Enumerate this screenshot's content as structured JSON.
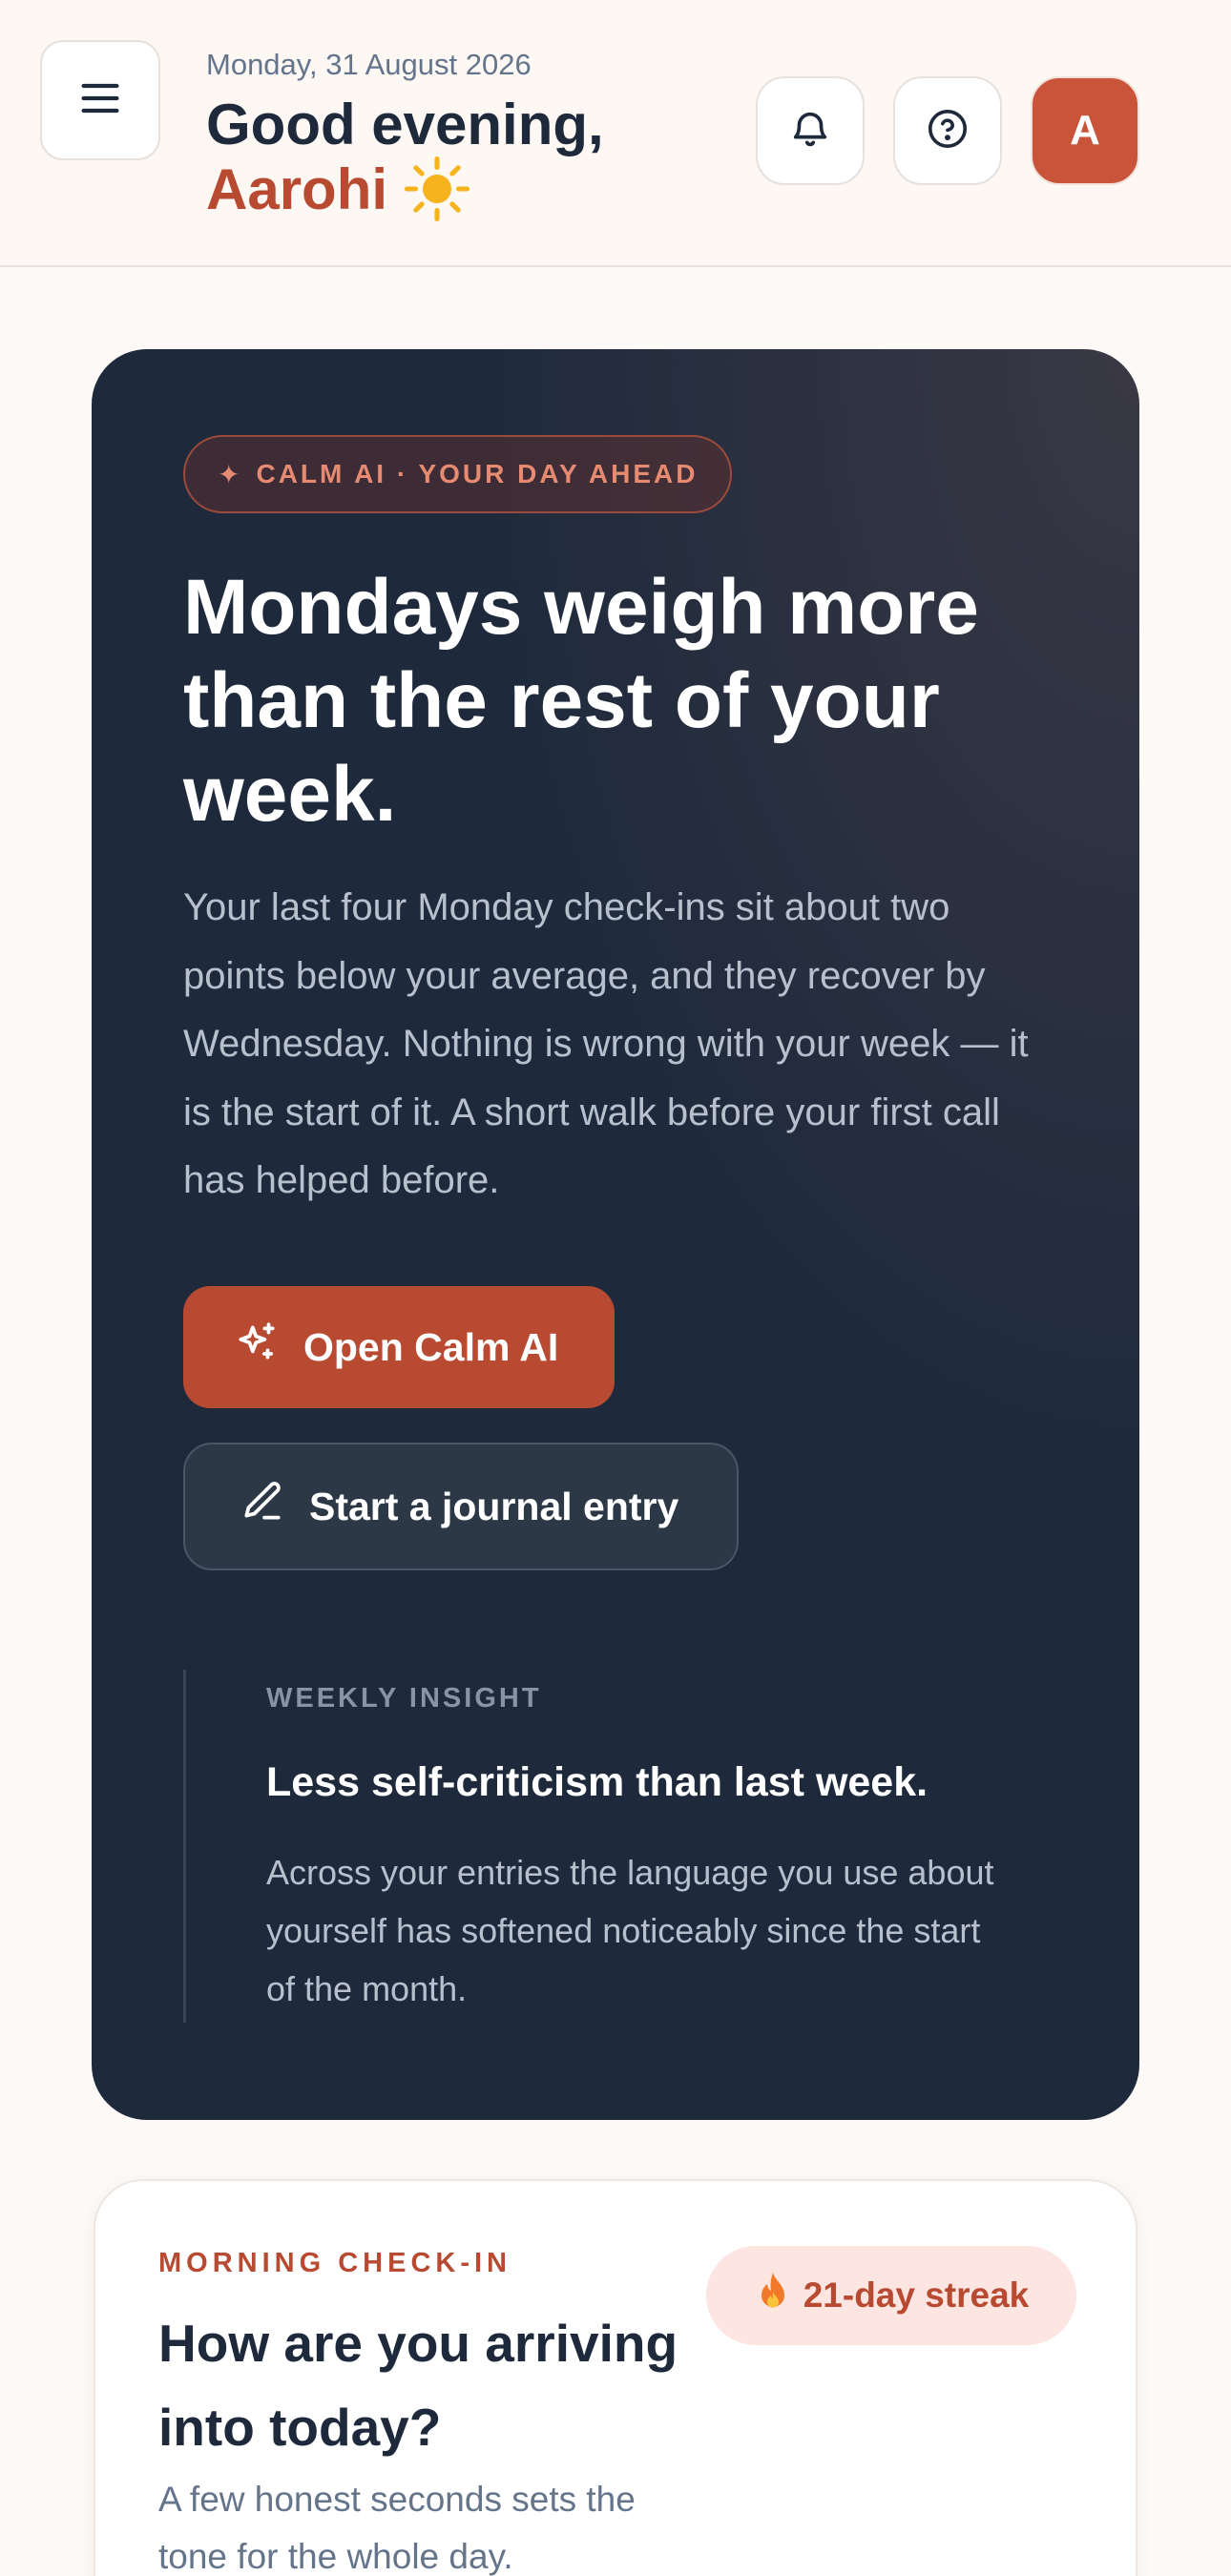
{
  "header": {
    "date": "Monday, 31 August 2026",
    "greeting": "Good evening,",
    "name": "Aarohi",
    "avatar_initial": "A",
    "icons": [
      "menu-icon",
      "bell-icon",
      "help-circle-icon",
      "sun-icon"
    ]
  },
  "hero": {
    "badge": "CALM AI · YOUR DAY AHEAD",
    "badge_icon": "sparkle-icon",
    "title": "Mondays weigh more than the rest of your week.",
    "body": "Your last four Monday check-ins sit about two points below your average, and they recover by Wednesday. Nothing is wrong with your week — it is the start of it. A short walk before your first call has helped before.",
    "primary_button": "Open Calm AI",
    "secondary_button": "Start a journal entry",
    "insight": {
      "label": "WEEKLY INSIGHT",
      "title": "Less self-criticism than last week.",
      "body": "Across your entries the language you use about yourself has softened noticeably since the start of the month."
    }
  },
  "checkin": {
    "label": "MORNING CHECK-IN",
    "title": "How are you arriving into today?",
    "subtitle": "A few honest seconds sets the tone for the whole day.",
    "streak": "21-day streak",
    "streak_icon": "fire-icon"
  },
  "colors": {
    "accent": "#b84a32",
    "hero_bg": "#1e2a3c",
    "page_bg": "#fdf9f6",
    "streak_bg": "#fde6e1"
  }
}
